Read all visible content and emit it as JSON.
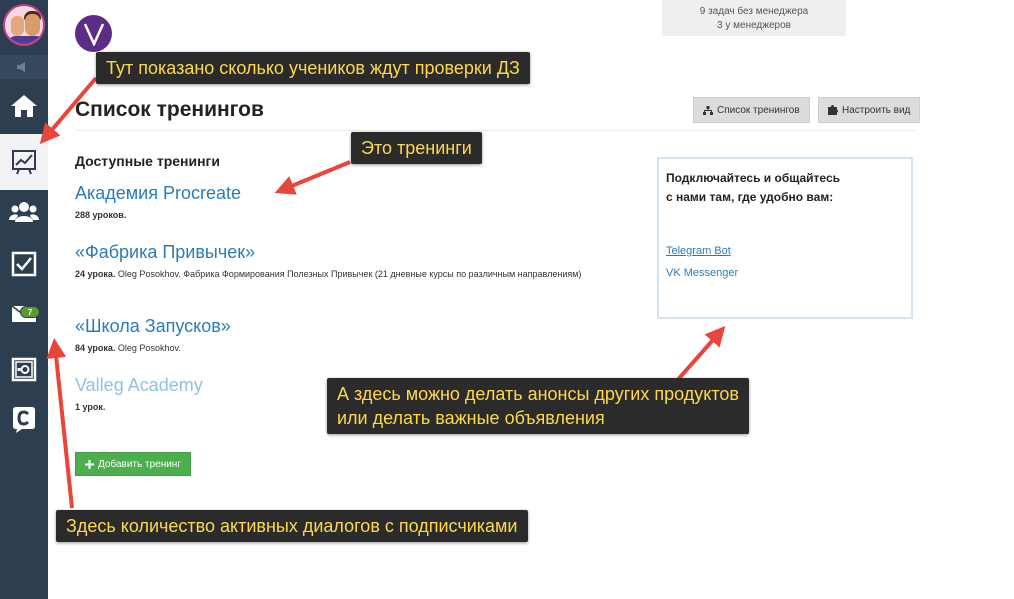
{
  "stats": {
    "line1": "9 задач без менеджера",
    "line2": "3 у менеджеров"
  },
  "sidebar": {
    "items": [
      {
        "icon": "home-icon"
      },
      {
        "icon": "chart-icon",
        "active": true
      },
      {
        "icon": "users-icon"
      },
      {
        "icon": "checkbox-icon"
      },
      {
        "icon": "mail-icon",
        "badge": "7"
      },
      {
        "icon": "safe-icon"
      },
      {
        "icon": "c-logo-icon"
      }
    ]
  },
  "header": {
    "title": "Список тренингов",
    "btn_list": "Список тренингов",
    "btn_settings": "Настроить вид"
  },
  "trainings": {
    "section_title": "Доступные тренинги",
    "items": [
      {
        "title": "Академия Procreate",
        "count": "288 уроков.",
        "desc": ""
      },
      {
        "title": "«Фабрика Привычек»",
        "count": "24 урока.",
        "desc": "Oleg Posokhov. Фабрика Формирования Полезных Привычек (21 дневные курсы по различным направлениям)"
      },
      {
        "title": "«Школа Запусков»",
        "count": "84 урока.",
        "desc": "Oleg Posokhov."
      },
      {
        "title": "Valleg Academy",
        "count": "1 урок.",
        "desc": ""
      }
    ],
    "add_button": "Добавить тренинг"
  },
  "contact": {
    "heading_line1": "Подключайтесь и общайтесь",
    "heading_line2": "с нами там, где удобно вам:",
    "link1": "Telegram Bot",
    "link2": "VK Messenger"
  },
  "annotations": {
    "homework": "Тут показано сколько учеников ждут проверки ДЗ",
    "trainings": "Это тренинги",
    "announce_line1": "А здесь можно делать анонсы других продуктов",
    "announce_line2": "или делать важные объявления",
    "dialogs": "Здесь количество активных диалогов с подписчиками"
  },
  "colors": {
    "sidebar": "#2c3e50",
    "link": "#2a7bb8",
    "add_button": "#4cae4c",
    "annotation_bg": "#2b2b2b",
    "annotation_text": "#ffd84a",
    "arrow": "#e8453c"
  }
}
